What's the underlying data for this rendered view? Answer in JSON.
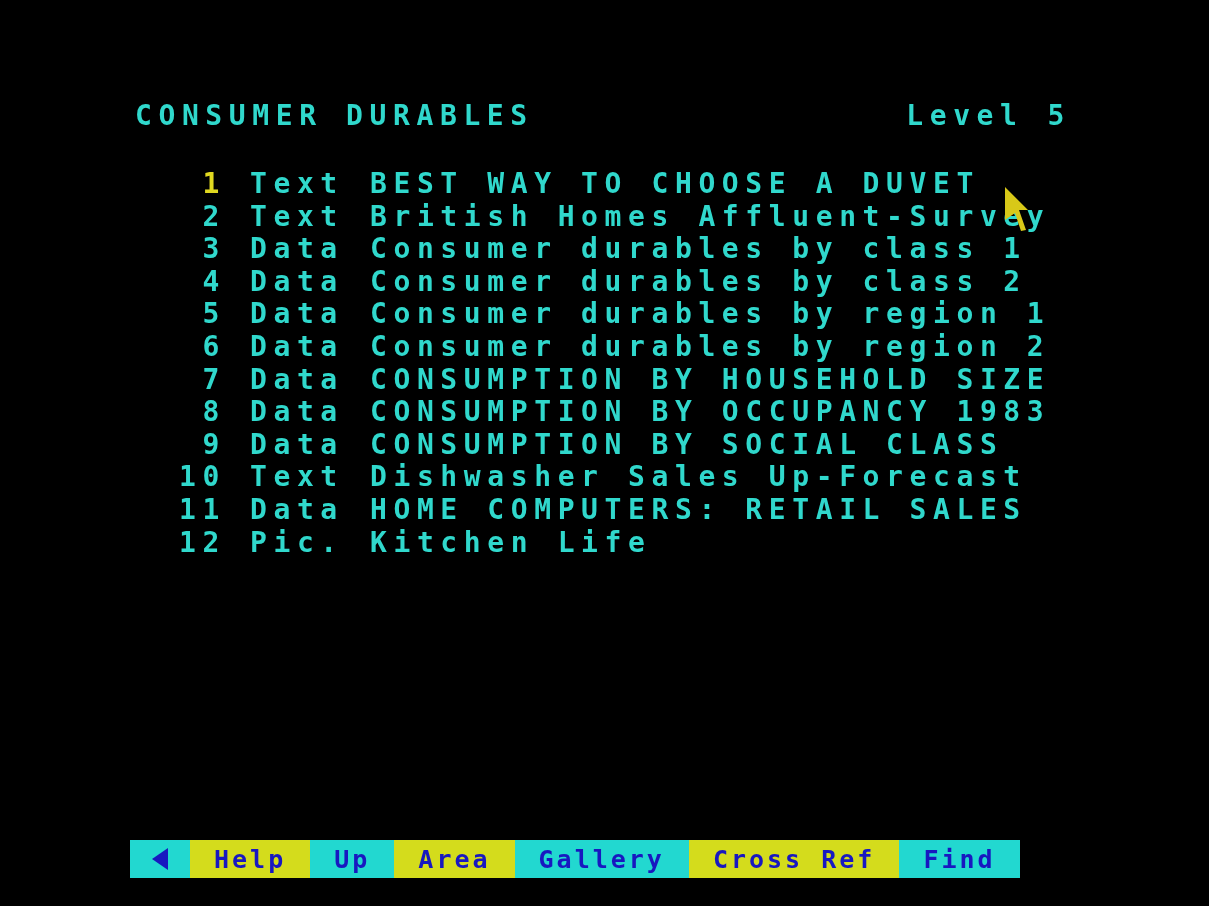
{
  "header": {
    "title": "CONSUMER DURABLES",
    "level_label": "Level",
    "level_value": "5"
  },
  "items": [
    {
      "number": "1",
      "type": "Text",
      "title": "BEST WAY TO CHOOSE A DUVET",
      "selected": true
    },
    {
      "number": "2",
      "type": "Text",
      "title": "British Homes Affluent-Survey",
      "selected": false
    },
    {
      "number": "3",
      "type": "Data",
      "title": "Consumer durables by class 1",
      "selected": false
    },
    {
      "number": "4",
      "type": "Data",
      "title": "Consumer durables by class 2",
      "selected": false
    },
    {
      "number": "5",
      "type": "Data",
      "title": "Consumer durables by region 1",
      "selected": false
    },
    {
      "number": "6",
      "type": "Data",
      "title": "Consumer durables by region 2",
      "selected": false
    },
    {
      "number": "7",
      "type": "Data",
      "title": "CONSUMPTION BY HOUSEHOLD SIZE",
      "selected": false
    },
    {
      "number": "8",
      "type": "Data",
      "title": "CONSUMPTION BY OCCUPANCY 1983",
      "selected": false
    },
    {
      "number": "9",
      "type": "Data",
      "title": "CONSUMPTION BY SOCIAL CLASS",
      "selected": false
    },
    {
      "number": "10",
      "type": "Text",
      "title": "Dishwasher Sales Up-Forecast",
      "selected": false
    },
    {
      "number": "11",
      "type": "Data",
      "title": "HOME COMPUTERS: RETAIL SALES",
      "selected": false
    },
    {
      "number": "12",
      "type": "Pic.",
      "title": "Kitchen Life",
      "selected": false
    }
  ],
  "menu_bar": [
    {
      "kind": "back",
      "color": "#22d8d0"
    },
    {
      "kind": "label",
      "label": "Help",
      "color": "#d4dc1c"
    },
    {
      "kind": "label",
      "label": "Up",
      "color": "#22d8d0"
    },
    {
      "kind": "label",
      "label": "Area",
      "color": "#d4dc1c"
    },
    {
      "kind": "label",
      "label": "Gallery",
      "color": "#22d8d0"
    },
    {
      "kind": "label",
      "label": "Cross Ref",
      "color": "#d4dc1c"
    },
    {
      "kind": "label",
      "label": "Find",
      "color": "#22d8d0"
    }
  ]
}
